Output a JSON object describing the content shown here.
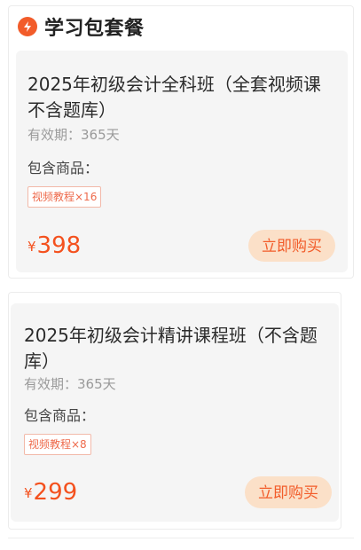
{
  "header": {
    "title": "学习包套餐",
    "icon": "lightning-icon",
    "accent_color": "#f25c2a"
  },
  "packages": [
    {
      "title": "2025年初级会计全科班（全套视频课不含题库）",
      "validity": "有效期：365天",
      "contains_label": "包含商品：",
      "tag": "视频教程×16",
      "currency": "¥",
      "price": "398",
      "buy_label": "立即购买"
    },
    {
      "title": "2025年初级会计精讲课程班（不含题库）",
      "validity": "有效期：365天",
      "contains_label": "包含商品：",
      "tag": "视频教程×8",
      "currency": "¥",
      "price": "299",
      "buy_label": "立即购买"
    }
  ],
  "colors": {
    "price": "#f4511e",
    "button_bg": "#fbe0c8",
    "card_bg": "#f5f5f5"
  }
}
